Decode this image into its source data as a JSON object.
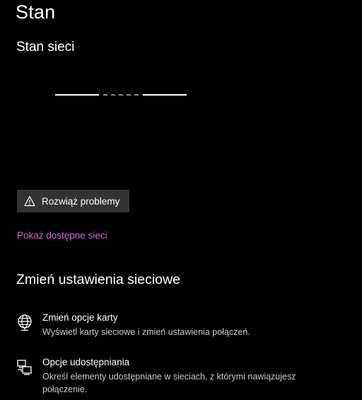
{
  "page": {
    "title": "Stan"
  },
  "network_status": {
    "heading": "Stan sieci"
  },
  "troubleshoot": {
    "label": "Rozwiąż problemy",
    "icon": "warning-icon"
  },
  "show_networks_link": "Pokaż dostępne sieci",
  "change_settings": {
    "heading": "Zmień ustawienia sieciowe",
    "options": [
      {
        "title": "Zmień opcje karty",
        "description": "Wyświetl karty sieciowe i zmień ustawienia połączeń.",
        "icon": "globe-network-icon"
      },
      {
        "title": "Opcje udostępniania",
        "description": "Określ elementy udostępniane w sieciach, z którymi nawiązujesz połączenie.",
        "icon": "sharing-icon"
      }
    ]
  },
  "colors": {
    "background": "#000000",
    "button": "#333333",
    "link": "#d166d6",
    "secondary_text": "#c8c8c8"
  }
}
